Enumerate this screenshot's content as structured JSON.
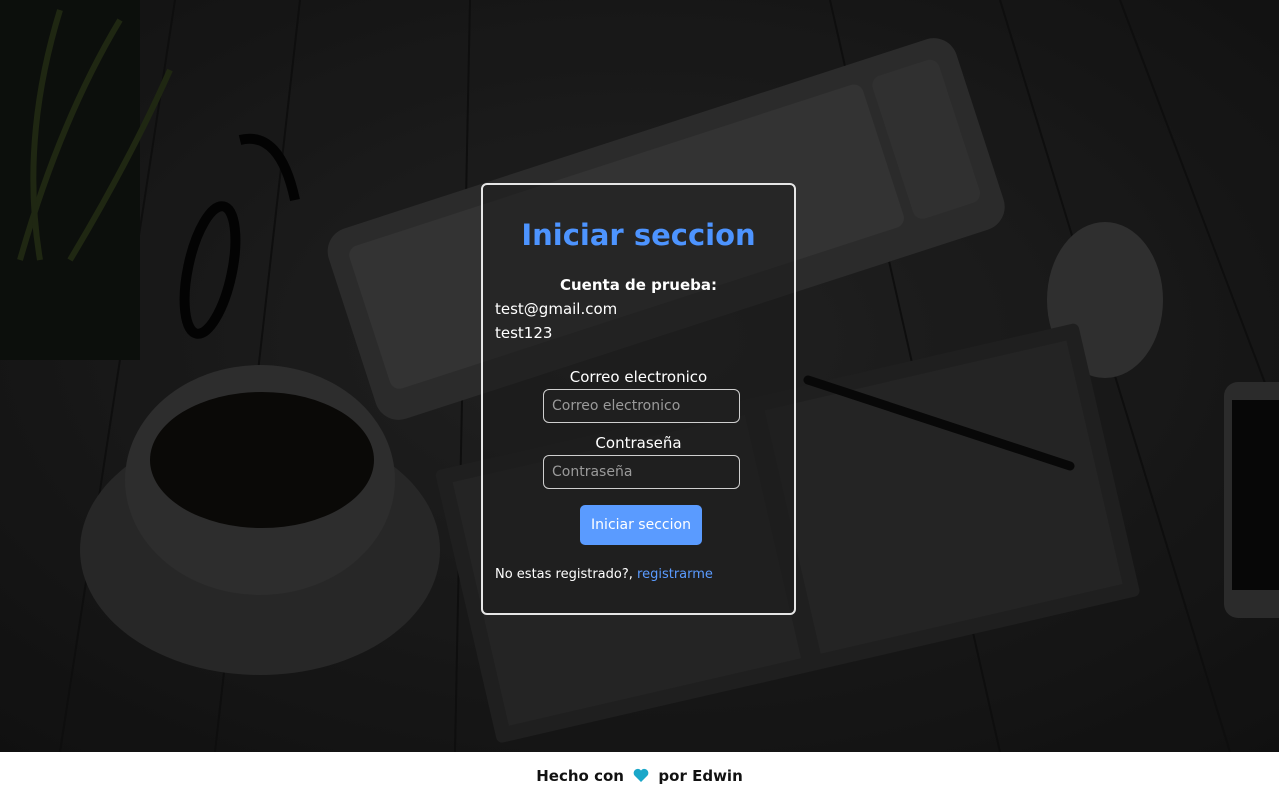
{
  "login": {
    "title": "Iniciar seccion",
    "test_account_heading": "Cuenta de prueba:",
    "test_email": "test@gmail.com",
    "test_password": "test123",
    "email_label": "Correo electronico",
    "email_placeholder": "Correo electronico",
    "email_value": "",
    "password_label": "Contraseña",
    "password_placeholder": "Contraseña",
    "password_value": "",
    "submit_label": "Iniciar seccion",
    "register_prompt": "No estas registrado?,",
    "register_link": "registrarme"
  },
  "footer": {
    "prefix": "Hecho con",
    "icon": "heart-icon",
    "suffix": "por Edwin"
  },
  "colors": {
    "accent": "#5a9bff",
    "title": "#4d94ff",
    "heart": "#1aa7c9",
    "footer_bg": "#ffffff"
  }
}
